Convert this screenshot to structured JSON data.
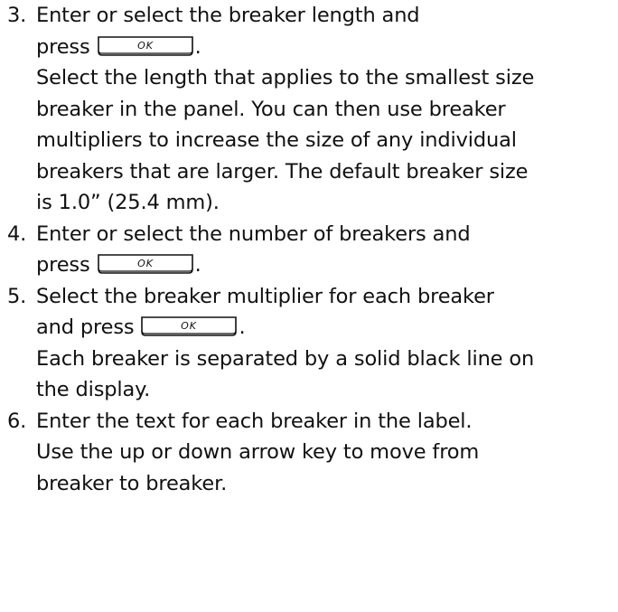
{
  "steps": [
    {
      "number": "3.",
      "lines": [
        "Enter or select the breaker length and",
        "press"
      ],
      "key_after_line": 1,
      "key_label": "OK",
      "after_key": ".",
      "note_lines": [
        "Select the length that applies to the smallest size",
        "breaker in the panel. You can then use breaker",
        "multipliers to increase the size of any individual",
        "breakers that are larger. The default breaker size",
        "is 1.0” (25.4 mm)."
      ]
    },
    {
      "number": "4.",
      "lines": [
        "Enter or select the number of breakers and",
        "press"
      ],
      "key_label": "OK",
      "after_key": "."
    },
    {
      "number": "5.",
      "lines": [
        "Select the breaker multiplier for each breaker",
        "and press"
      ],
      "key_label": "OK",
      "after_key": ".",
      "note_lines": [
        "Each breaker is separated by a solid black line on",
        "the display."
      ]
    },
    {
      "number": "6.",
      "lines": [
        "Enter the text for each breaker in the label.",
        "Use the up or down arrow key to move from",
        "breaker to breaker."
      ]
    }
  ]
}
